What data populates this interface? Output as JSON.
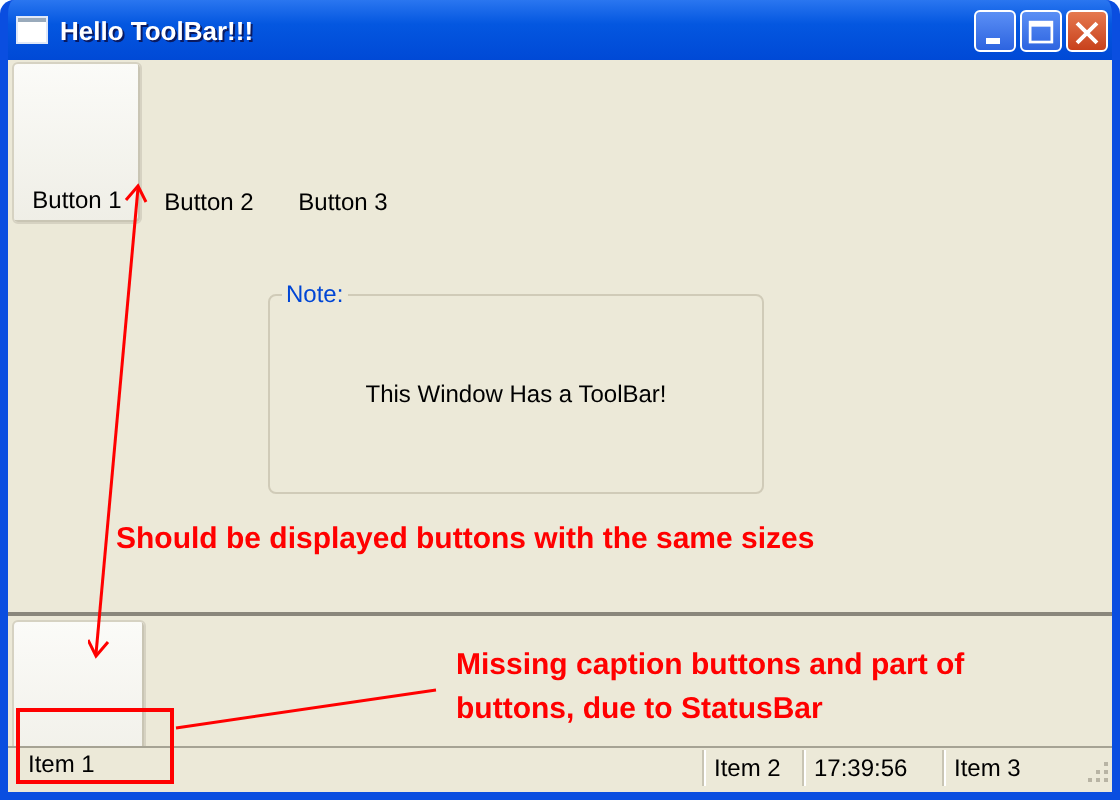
{
  "window": {
    "title": "Hello ToolBar!!!"
  },
  "top_toolbar": {
    "buttons": [
      {
        "label": "Button 1",
        "raised": true
      },
      {
        "label": "Button 2",
        "raised": false
      },
      {
        "label": "Button 3",
        "raised": false
      }
    ]
  },
  "group_box": {
    "legend": "Note:",
    "text": "This Window Has a ToolBar!"
  },
  "status_bar": {
    "panels": [
      "Item 1",
      "Item 2",
      "17:39:56",
      "Item 3"
    ]
  },
  "annotations": [
    {
      "text": "Should be displayed buttons with the same sizes"
    },
    {
      "text": "Missing caption buttons and part of buttons, due to StatusBar"
    }
  ]
}
